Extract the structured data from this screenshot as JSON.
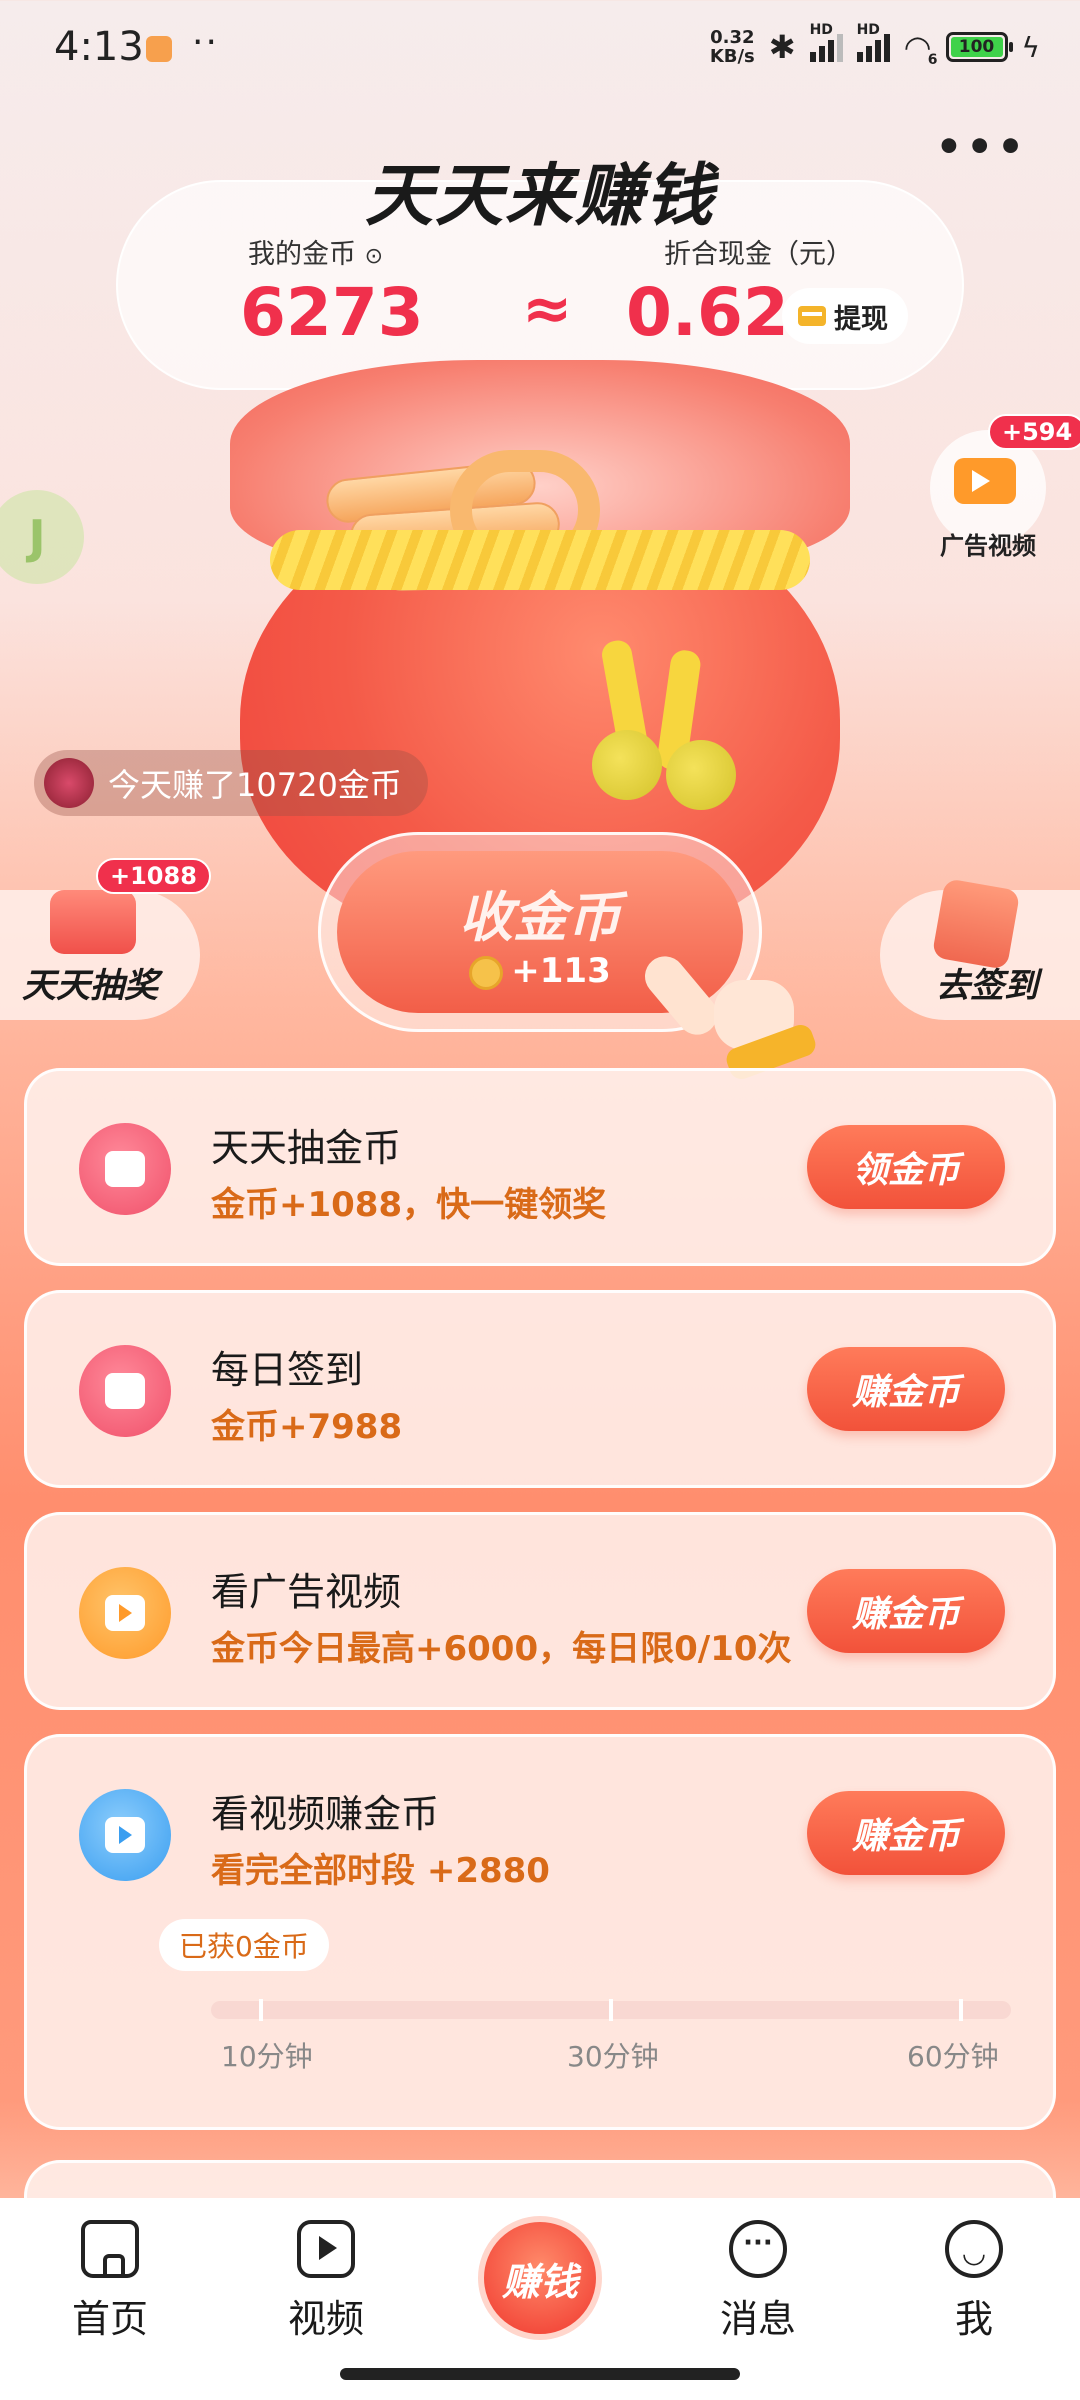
{
  "status_bar": {
    "time": "4:13",
    "dots": "··",
    "net_speed_value": "0.32",
    "net_speed_unit": "KB/s",
    "battery": "100",
    "hd1": "HD",
    "hd2": "HD",
    "wifi_badge": "6"
  },
  "header": {
    "title": "天天来赚钱",
    "more": "•••",
    "my_coins_label": "我的金币",
    "coins": "6273",
    "approx_symbol": "≈",
    "cash_label": "折合现金（元）",
    "cash": "0.62",
    "withdraw": "提现"
  },
  "floating": {
    "android_letter": "J",
    "ad_video_badge": "+594",
    "ad_video_label": "广告视频",
    "earned_today": "今天赚了10720金币",
    "lottery_badge": "+1088",
    "lottery_label": "天天抽奖",
    "signin_label": "去签到",
    "collect_title": "收金币",
    "collect_amount": "+113"
  },
  "tasks": [
    {
      "title": "天天抽金币",
      "desc": "金币+1088，快一键领奖",
      "button": "领金币",
      "icon": "lottery-icon"
    },
    {
      "title": "每日签到",
      "desc": "金币+7988",
      "button": "赚金币",
      "icon": "calendar-icon"
    },
    {
      "title": "看广告视频",
      "desc": "金币今日最高+6000，每日限0/10次",
      "button": "赚金币",
      "icon": "video-camera-icon"
    },
    {
      "title": "看视频赚金币",
      "desc": "看完全部时段 +2880",
      "button": "赚金币",
      "icon": "video-camera-icon",
      "obtained": "已获0金币",
      "milestones": [
        "10分钟",
        "30分钟",
        "60分钟"
      ],
      "progress": 0
    }
  ],
  "bottom_nav": {
    "home": "首页",
    "video": "视频",
    "earn": "赚钱",
    "messages": "消息",
    "me": "我"
  },
  "colors": {
    "accent_red": "#f0304c",
    "accent_orange": "#d96a18",
    "button_orange": "#f2523a"
  }
}
